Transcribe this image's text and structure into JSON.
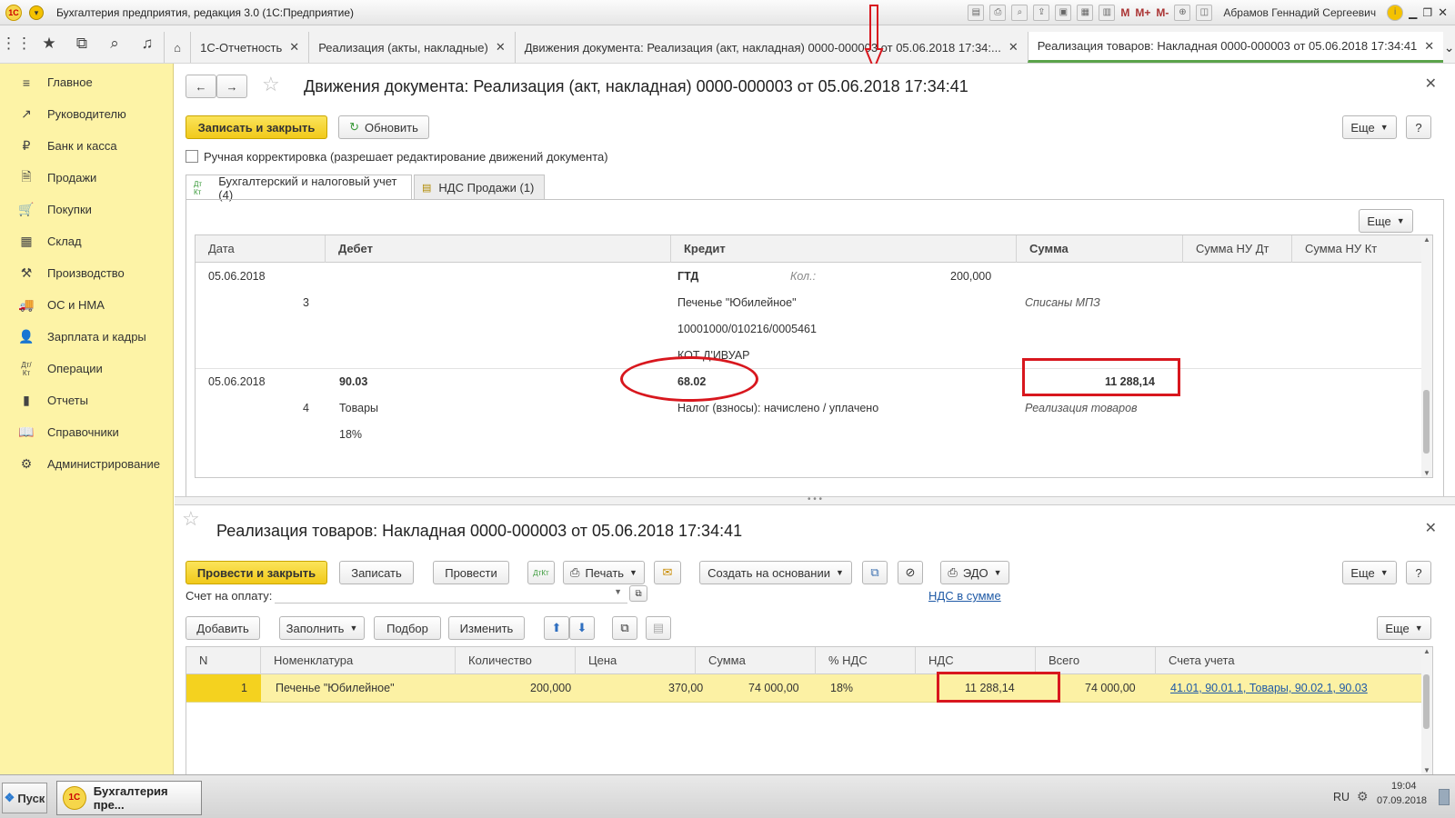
{
  "window": {
    "title": "Бухгалтерия предприятия, редакция 3.0 (1С:Предприятие)",
    "user": "Абрамов Геннадий Сергеевич",
    "m1": "M",
    "m2": "M+",
    "m3": "M-"
  },
  "tabs": [
    {
      "label": "1С-Отчетность"
    },
    {
      "label": "Реализация (акты, накладные)"
    },
    {
      "label": "Движения документа: Реализация (акт, накладная) 0000-000003 от 05.06.2018 17:34:..."
    },
    {
      "label": "Реализация товаров: Накладная 0000-000003 от 05.06.2018 17:34:41"
    }
  ],
  "sidebar": {
    "items": [
      {
        "label": "Главное",
        "icon": "≡"
      },
      {
        "label": "Руководителю",
        "icon": "↗"
      },
      {
        "label": "Банк и касса",
        "icon": "₽"
      },
      {
        "label": "Продажи",
        "icon": "🗎"
      },
      {
        "label": "Покупки",
        "icon": "🛒"
      },
      {
        "label": "Склад",
        "icon": "▦"
      },
      {
        "label": "Производство",
        "icon": "⚒"
      },
      {
        "label": "ОС и НМА",
        "icon": "🚚"
      },
      {
        "label": "Зарплата и кадры",
        "icon": "👤"
      },
      {
        "label": "Операции",
        "icon": "Дт/Кт"
      },
      {
        "label": "Отчеты",
        "icon": "▮"
      },
      {
        "label": "Справочники",
        "icon": "📖"
      },
      {
        "label": "Администрирование",
        "icon": "⚙"
      }
    ]
  },
  "movements": {
    "title": "Движения документа: Реализация (акт, накладная) 0000-000003 от 05.06.2018 17:34:41",
    "save_close": "Записать и закрыть",
    "refresh": "Обновить",
    "more": "Еще",
    "help": "?",
    "manual_label": "Ручная корректировка (разрешает редактирование движений документа)",
    "tab1": "Бухгалтерский и налоговый учет (4)",
    "tab2": "НДС Продажи (1)",
    "grid_more": "Еще",
    "columns": [
      "Дата",
      "Дебет",
      "Кредит",
      "Сумма",
      "Сумма НУ Дт",
      "Сумма НУ Кт"
    ],
    "row1": {
      "date": "05.06.2018",
      "num": "3",
      "credit_acc": "ГТД",
      "kol_label": "Кол.:",
      "qty": "200,000",
      "c1": "Печенье \"Юбилейное\"",
      "c2": "10001000/010216/0005461",
      "c3": "КОТ Д'ИВУАР",
      "sum_note": "Списаны МПЗ"
    },
    "row2": {
      "date": "05.06.2018",
      "num": "4",
      "debit_acc": "90.03",
      "d1": "Товары",
      "d2": "18%",
      "credit_acc": "68.02",
      "c1": "Налог (взносы): начислено / уплачено",
      "sum": "11 288,14",
      "sum_note": "Реализация товаров"
    }
  },
  "invoice": {
    "title": "Реализация товаров: Накладная 0000-000003 от 05.06.2018 17:34:41",
    "post_close": "Провести и закрыть",
    "save": "Записать",
    "post": "Провести",
    "print": "Печать",
    "create_based": "Создать на основании",
    "edo": "ЭДО",
    "more": "Еще",
    "help": "?",
    "pay_label": "Счет на оплату:",
    "vat_link": "НДС в сумме",
    "add": "Добавить",
    "fill": "Заполнить",
    "select": "Подбор",
    "change": "Изменить",
    "grid_more": "Еще",
    "columns": [
      "N",
      "Номенклатура",
      "Количество",
      "Цена",
      "Сумма",
      "% НДС",
      "НДС",
      "Всего",
      "Счета учета"
    ],
    "row": {
      "n": "1",
      "name": "Печенье \"Юбилейное\"",
      "qty": "200,000",
      "price": "370,00",
      "sum": "74 000,00",
      "vat_rate": "18%",
      "vat": "11 288,14",
      "total": "74 000,00",
      "accounts": "41.01, 90.01.1, Товары, 90.02.1, 90.03"
    }
  },
  "taskbar": {
    "start": "Пуск",
    "task": "Бухгалтерия пре...",
    "lang": "RU",
    "time": "19:04",
    "date": "07.09.2018"
  },
  "colors": {
    "accent_yellow": "#fdf3a6",
    "button_yellow": "#f1c91a",
    "highlight_red": "#d8171e",
    "row_selected": "#fcf1a4"
  }
}
